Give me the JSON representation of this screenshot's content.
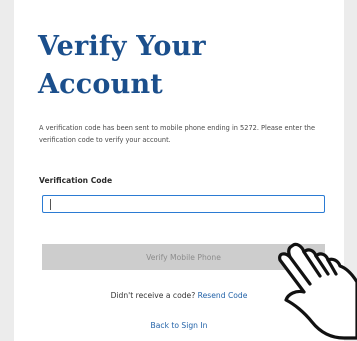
{
  "page": {
    "title_line1": "Verify Your",
    "title_line2": "Account",
    "description": "A verification code has been sent to mobile phone ending in 5272. Please enter the verification code to verify your account."
  },
  "form": {
    "code_label": "Verification Code",
    "code_value": "",
    "verify_button_label": "Verify Mobile Phone"
  },
  "footer": {
    "resend_prompt": "Didn't receive a code?",
    "resend_link": "Resend Code",
    "back_link": "Back to Sign In"
  },
  "colors": {
    "title": "#1b4f8c",
    "link": "#2262a8",
    "input_focus_border": "#2b7bd3",
    "button_disabled_bg": "#cdcdcd"
  },
  "icons": {
    "overlay": "pointing-hand-icon"
  }
}
